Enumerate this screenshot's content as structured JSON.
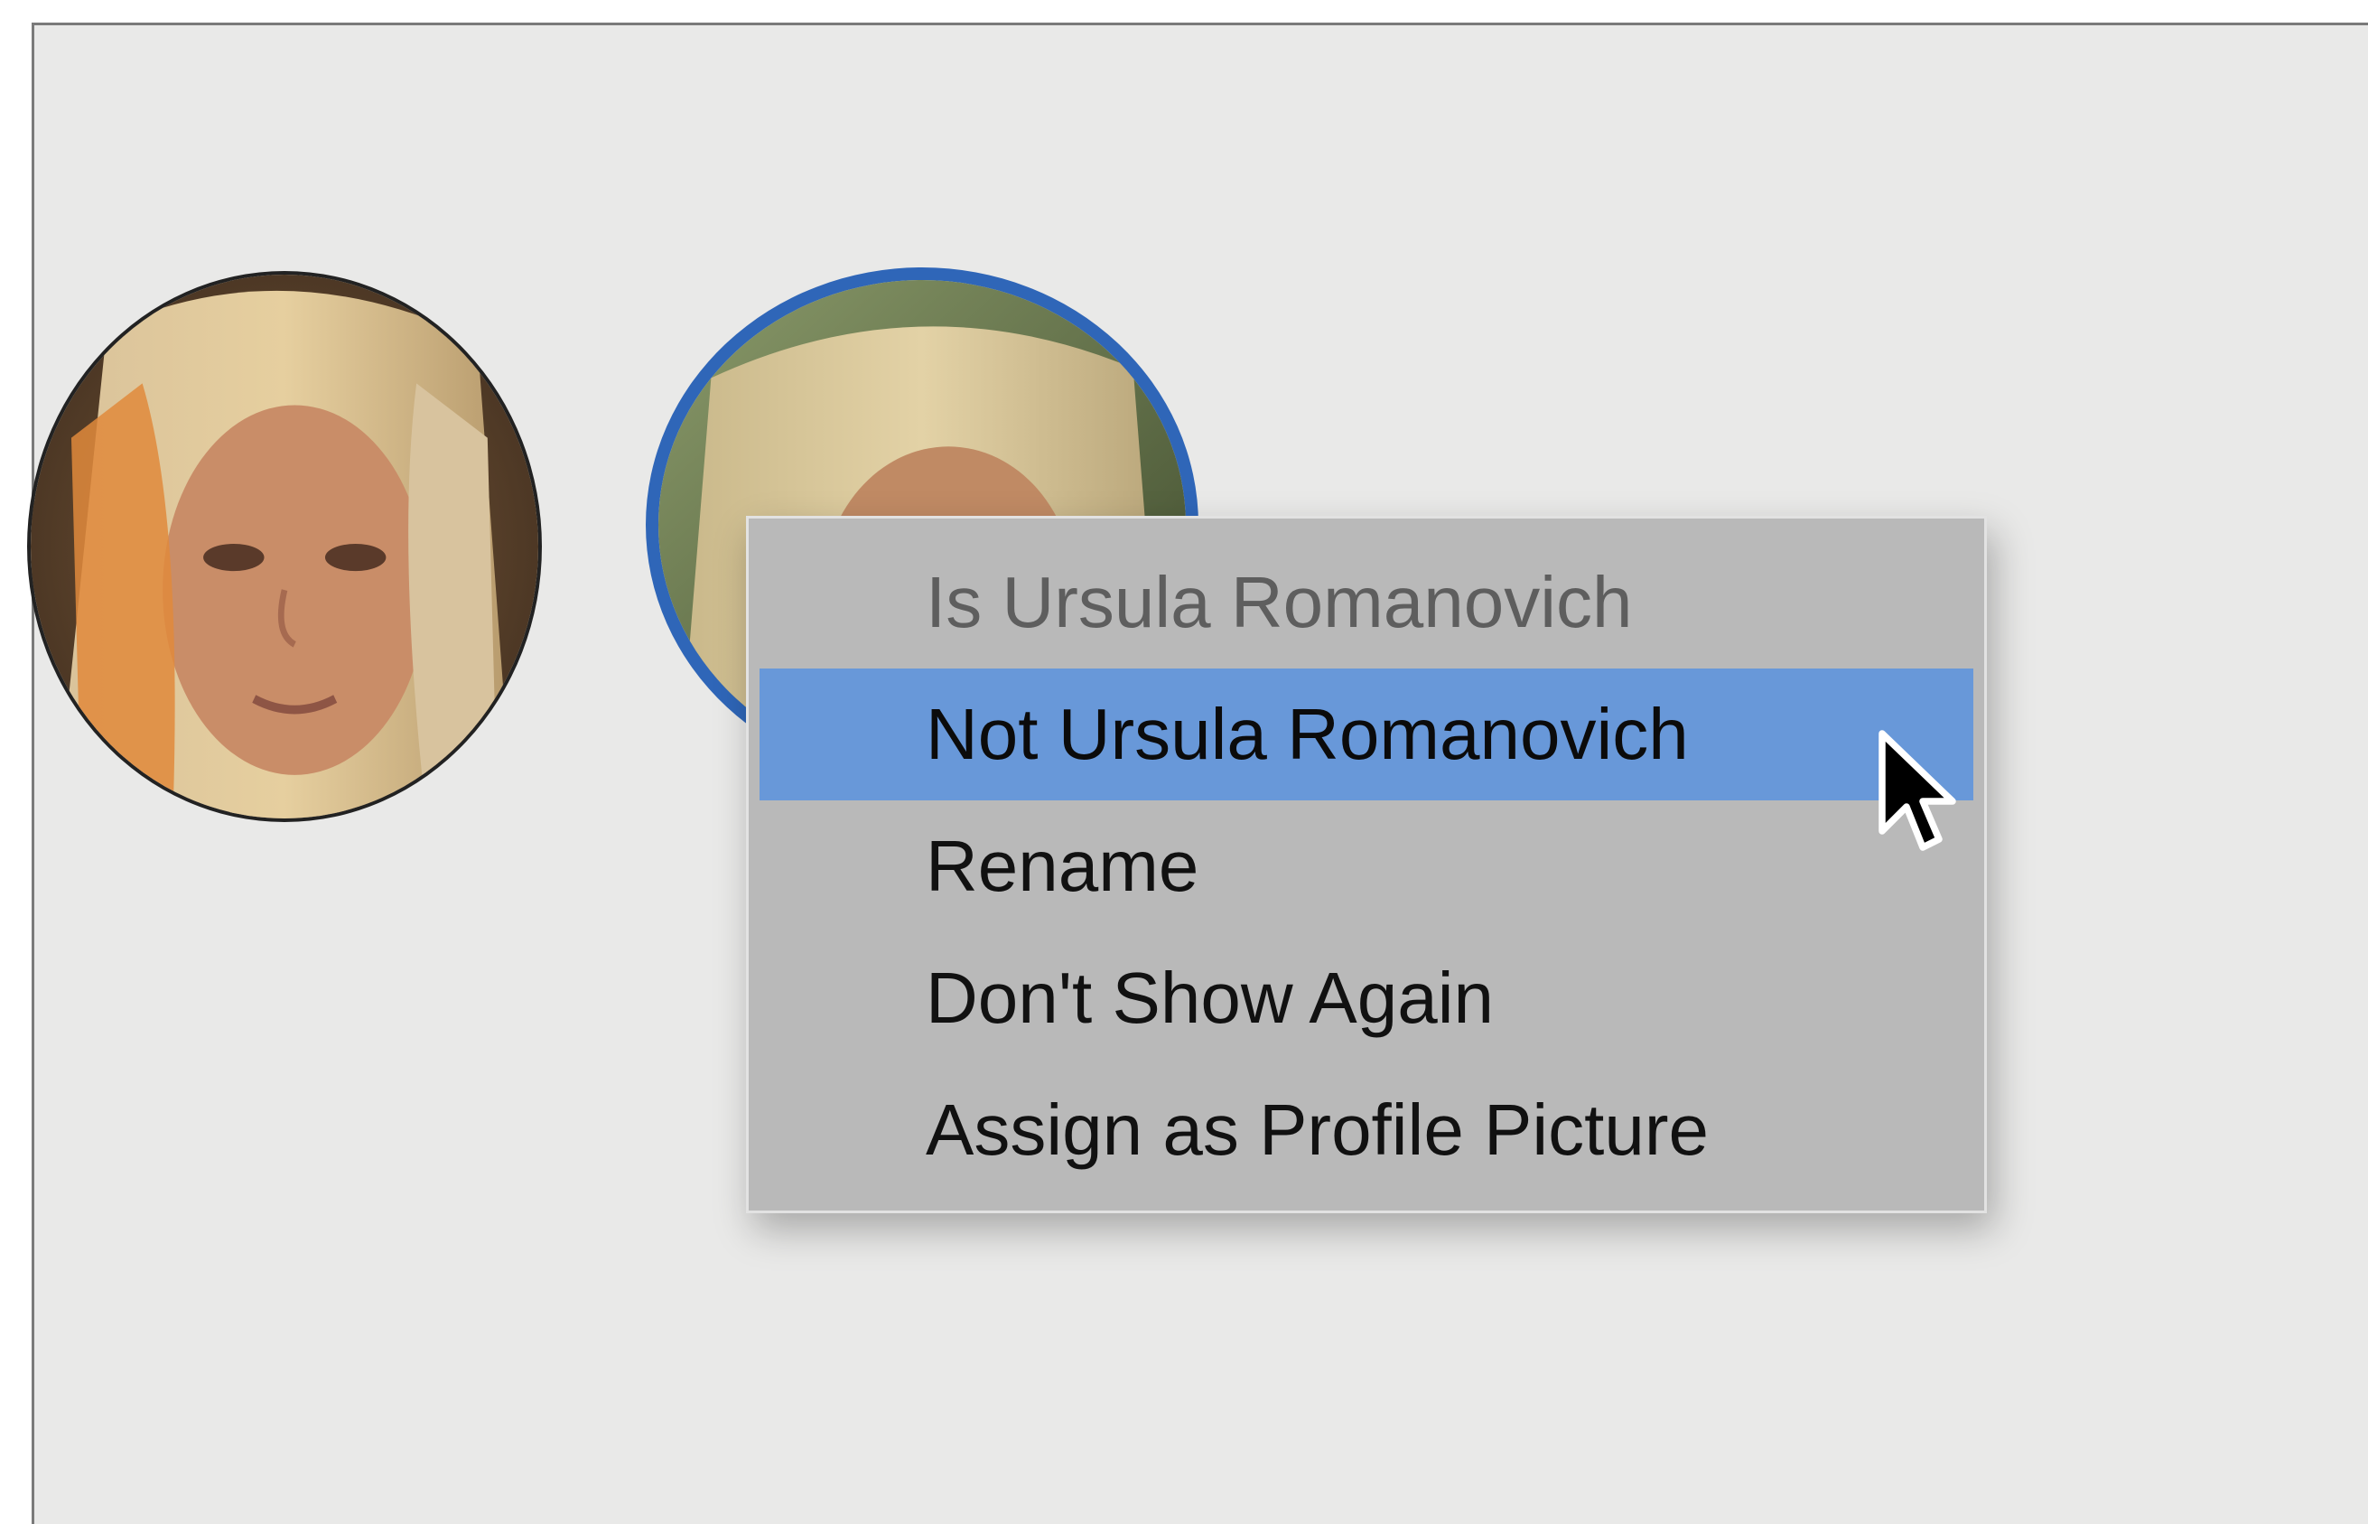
{
  "context_menu": {
    "items": [
      {
        "label": "Is Ursula Romanovich",
        "state": "disabled"
      },
      {
        "label": "Not Ursula Romanovich",
        "state": "highlighted"
      },
      {
        "label": "Rename",
        "state": "normal"
      },
      {
        "label": "Don't Show Again",
        "state": "normal"
      },
      {
        "label": "Assign as Profile Picture",
        "state": "normal"
      }
    ]
  },
  "faces": [
    {
      "icon": "face-thumbnail",
      "selected": false
    },
    {
      "icon": "face-thumbnail",
      "selected": true
    }
  ],
  "colors": {
    "background": "#e9e9e8",
    "menu_background": "#b9b9b9",
    "highlight": "#6898d9",
    "selection_ring": "#2f66b8"
  },
  "cursor": {
    "icon": "arrow-pointer-icon"
  }
}
